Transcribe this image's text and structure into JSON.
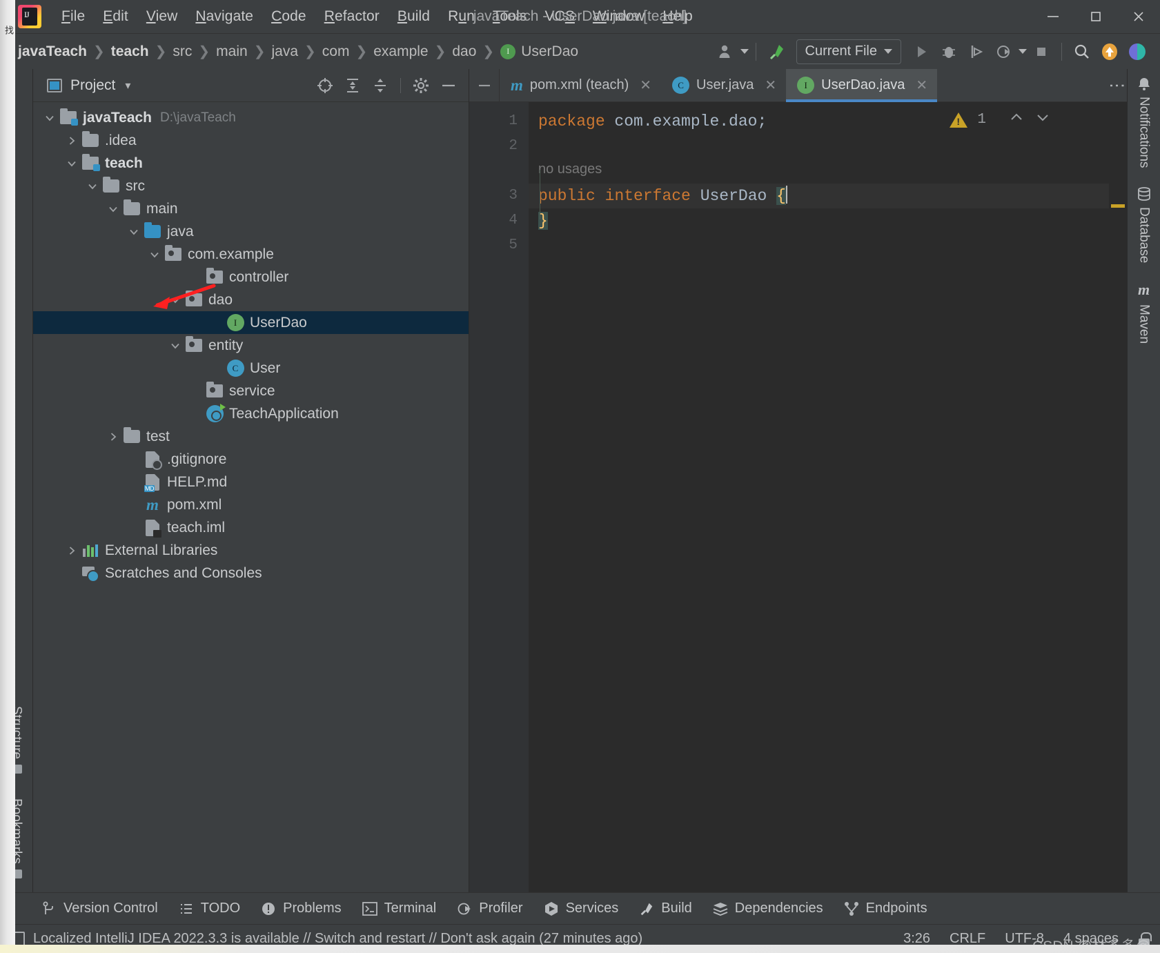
{
  "window": {
    "title": "javaTeach - UserDao.java [teach]",
    "minimize": "—",
    "maximize": "▢",
    "close": "✕"
  },
  "menu": {
    "items": [
      {
        "label": "File",
        "mnemonic": "F"
      },
      {
        "label": "Edit",
        "mnemonic": "E"
      },
      {
        "label": "View",
        "mnemonic": "V"
      },
      {
        "label": "Navigate",
        "mnemonic": "N"
      },
      {
        "label": "Code",
        "mnemonic": "C"
      },
      {
        "label": "Refactor",
        "mnemonic": "R"
      },
      {
        "label": "Build",
        "mnemonic": "B"
      },
      {
        "label": "Run",
        "mnemonic": "u"
      },
      {
        "label": "Tools",
        "mnemonic": "T"
      },
      {
        "label": "VCS",
        "mnemonic": "S"
      },
      {
        "label": "Window",
        "mnemonic": "W"
      },
      {
        "label": "Help",
        "mnemonic": "H"
      }
    ]
  },
  "navbar": {
    "breadcrumbs": [
      {
        "label": "javaTeach",
        "bold": true
      },
      {
        "label": "teach",
        "bold": true
      },
      {
        "label": "src",
        "bold": false
      },
      {
        "label": "main",
        "bold": false
      },
      {
        "label": "java",
        "bold": false
      },
      {
        "label": "com",
        "bold": false
      },
      {
        "label": "example",
        "bold": false
      },
      {
        "label": "dao",
        "bold": false
      },
      {
        "label": "UserDao",
        "bold": false,
        "icon": "interface-icon",
        "icon_letter": "I"
      }
    ],
    "run_configuration": "Current File",
    "buttons": [
      "account-icon",
      "build-hammer-icon",
      "run-icon",
      "debug-icon",
      "run-with-coverage-icon",
      "profiler-icon",
      "stop-icon",
      "search-icon",
      "update-icon",
      "ide-assistant-icon"
    ]
  },
  "left_stripe": {
    "top": [
      {
        "label": "Project",
        "icon": "project-folder-icon",
        "active": true
      }
    ],
    "bottom": [
      {
        "label": "Structure",
        "icon": "structure-icon"
      },
      {
        "label": "Bookmarks",
        "icon": "bookmark-icon"
      }
    ]
  },
  "right_stripe": {
    "items": [
      {
        "label": "Notifications",
        "icon": "bell-icon"
      },
      {
        "label": "Database",
        "icon": "database-icon"
      },
      {
        "label": "Maven",
        "icon": "maven-m-icon"
      }
    ]
  },
  "project_panel": {
    "title": "Project",
    "title_chevron": "▾",
    "actions": [
      "select-opened-file-icon",
      "expand-all-icon",
      "collapse-all-icon",
      "settings-gear-icon",
      "hide-icon"
    ],
    "tree": [
      {
        "label": "javaTeach",
        "sub": "D:\\javaTeach",
        "depth": 0,
        "icon": "module-folder-icon",
        "twisty": "down",
        "bold": true,
        "selected": false
      },
      {
        "label": ".idea",
        "sub": "",
        "depth": 1,
        "icon": "folder-icon",
        "twisty": "right",
        "bold": false,
        "selected": false
      },
      {
        "label": "teach",
        "sub": "",
        "depth": 1,
        "icon": "module-folder-icon",
        "twisty": "down",
        "bold": true,
        "selected": false
      },
      {
        "label": "src",
        "sub": "",
        "depth": 2,
        "icon": "folder-icon",
        "twisty": "down",
        "bold": false,
        "selected": false
      },
      {
        "label": "main",
        "sub": "",
        "depth": 3,
        "icon": "folder-icon",
        "twisty": "down",
        "bold": false,
        "selected": false
      },
      {
        "label": "java",
        "sub": "",
        "depth": 4,
        "icon": "source-root-folder-icon",
        "twisty": "down",
        "bold": false,
        "selected": false
      },
      {
        "label": "com.example",
        "sub": "",
        "depth": 5,
        "icon": "package-icon",
        "twisty": "down",
        "bold": false,
        "selected": false
      },
      {
        "label": "controller",
        "sub": "",
        "depth": 6,
        "icon": "package-icon",
        "twisty": "none",
        "bold": false,
        "selected": false
      },
      {
        "label": "dao",
        "sub": "",
        "depth": 6,
        "icon": "package-icon",
        "twisty": "down",
        "bold": false,
        "selected": false
      },
      {
        "label": "UserDao",
        "sub": "",
        "depth": 7,
        "icon": "interface-icon",
        "twisty": "none",
        "bold": false,
        "selected": true
      },
      {
        "label": "entity",
        "sub": "",
        "depth": 6,
        "icon": "package-icon",
        "twisty": "down",
        "bold": false,
        "selected": false
      },
      {
        "label": "User",
        "sub": "",
        "depth": 7,
        "icon": "class-icon",
        "twisty": "none",
        "bold": false,
        "selected": false
      },
      {
        "label": "service",
        "sub": "",
        "depth": 6,
        "icon": "package-icon",
        "twisty": "none",
        "bold": false,
        "selected": false
      },
      {
        "label": "TeachApplication",
        "sub": "",
        "depth": 6,
        "icon": "spring-boot-class-icon",
        "twisty": "none",
        "bold": false,
        "selected": false
      },
      {
        "label": "test",
        "sub": "",
        "depth": 3,
        "icon": "folder-icon",
        "twisty": "right",
        "bold": false,
        "selected": false
      },
      {
        "label": ".gitignore",
        "sub": "",
        "depth": 3,
        "icon": "gitignore-file-icon",
        "twisty": "none",
        "bold": false,
        "selected": false
      },
      {
        "label": "HELP.md",
        "sub": "",
        "depth": 3,
        "icon": "markdown-file-icon",
        "twisty": "none",
        "bold": false,
        "selected": false
      },
      {
        "label": "pom.xml",
        "sub": "",
        "depth": 3,
        "icon": "maven-pom-icon",
        "twisty": "none",
        "bold": false,
        "selected": false
      },
      {
        "label": "teach.iml",
        "sub": "",
        "depth": 3,
        "icon": "iml-file-icon",
        "twisty": "none",
        "bold": false,
        "selected": false
      },
      {
        "label": "External Libraries",
        "sub": "",
        "depth": 1,
        "icon": "libraries-icon",
        "twisty": "right",
        "bold": false,
        "selected": false
      },
      {
        "label": "Scratches and Consoles",
        "sub": "",
        "depth": 1,
        "icon": "scratches-icon",
        "twisty": "none",
        "bold": false,
        "selected": false
      }
    ]
  },
  "editor": {
    "tabs": [
      {
        "label": "pom.xml (teach)",
        "icon": "maven-pom-icon",
        "active": false,
        "close": "✕"
      },
      {
        "label": "User.java",
        "icon": "class-icon",
        "active": false,
        "close": "✕"
      },
      {
        "label": "UserDao.java",
        "icon": "interface-icon",
        "active": true,
        "close": "✕"
      }
    ],
    "tab_options": "⋮",
    "gutter_lines": [
      "1",
      "2",
      "3",
      "4",
      "5"
    ],
    "inspection": {
      "warning_count": "1",
      "prev": "⌃",
      "next": "⌄"
    },
    "code": {
      "line1": {
        "kw": "package",
        "rest": " com.example.dao;"
      },
      "line_hint": "no usages",
      "line3": {
        "kw1": "public",
        "kw2": "interface",
        "name": "UserDao",
        "brace": "{"
      },
      "line4": {
        "brace": "}"
      }
    }
  },
  "tool_window_bar": [
    {
      "label": "Version Control",
      "icon": "branch-icon"
    },
    {
      "label": "TODO",
      "icon": "todo-list-icon"
    },
    {
      "label": "Problems",
      "icon": "problems-icon"
    },
    {
      "label": "Terminal",
      "icon": "terminal-icon"
    },
    {
      "label": "Profiler",
      "icon": "profiler-icon"
    },
    {
      "label": "Services",
      "icon": "services-icon"
    },
    {
      "label": "Build",
      "icon": "build-hammer-icon"
    },
    {
      "label": "Dependencies",
      "icon": "dependencies-icon"
    },
    {
      "label": "Endpoints",
      "icon": "endpoints-icon"
    }
  ],
  "status_bar": {
    "message": "Localized IntelliJ IDEA 2022.3.3 is available // Switch and restart // Don't ask again (27 minutes ago)",
    "message_icon": "notification-doc-icon",
    "caret_position": "3:26",
    "line_separator": "CRLF",
    "encoding": "UTF-8",
    "indent": "4 spaces",
    "lock": "lock-icon"
  },
  "watermark": "CSDN @林多多@",
  "colors": {
    "accent_blue": "#4a88c7",
    "selection_blue": "#0d293e",
    "panel_bg": "#3c3f41",
    "editor_bg": "#2b2b2b",
    "keyword_orange": "#cc7832",
    "warning_yellow": "#c9a227",
    "interface_green": "#62a862",
    "class_blue": "#3f9bc4",
    "annotation_red": "#ff2020"
  }
}
